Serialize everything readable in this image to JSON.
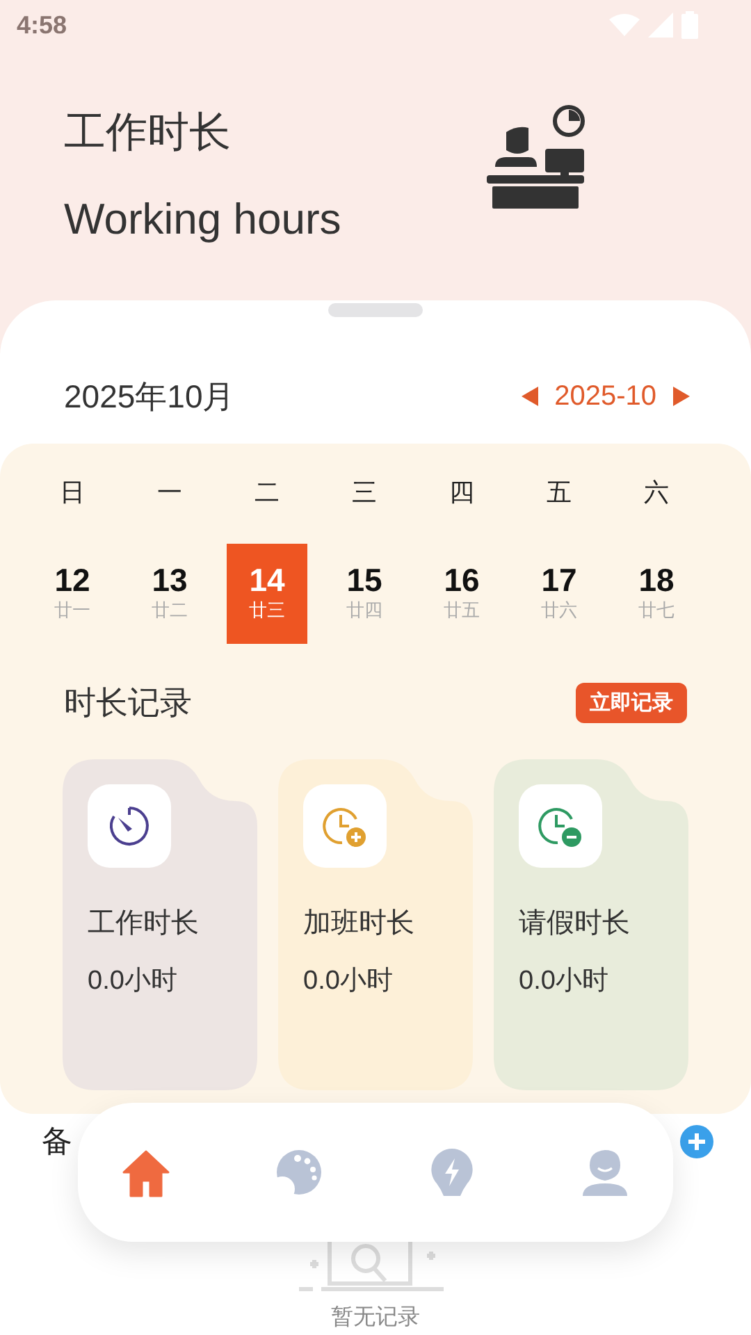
{
  "status_bar": {
    "time": "4:58"
  },
  "header": {
    "title": "工作时长",
    "subtitle": "Working hours"
  },
  "month": {
    "title": "2025年10月",
    "picker": "2025-10"
  },
  "calendar": {
    "weekdays": [
      "日",
      "一",
      "二",
      "三",
      "四",
      "五",
      "六"
    ],
    "days": [
      {
        "day": "12",
        "lunar": "廿一",
        "selected": false
      },
      {
        "day": "13",
        "lunar": "廿二",
        "selected": false
      },
      {
        "day": "14",
        "lunar": "廿三",
        "selected": true
      },
      {
        "day": "15",
        "lunar": "廿四",
        "selected": false
      },
      {
        "day": "16",
        "lunar": "廿五",
        "selected": false
      },
      {
        "day": "17",
        "lunar": "廿六",
        "selected": false
      },
      {
        "day": "18",
        "lunar": "廿七",
        "selected": false
      }
    ]
  },
  "records": {
    "title": "时长记录",
    "button": "立即记录",
    "cards": [
      {
        "kind": "work",
        "label": "工作时长",
        "value": "0.0小时",
        "color": "#ede5e3"
      },
      {
        "kind": "overtime",
        "label": "加班时长",
        "value": "0.0小时",
        "color": "#fdf0d8"
      },
      {
        "kind": "leave",
        "label": "请假时长",
        "value": "0.0小时",
        "color": "#e8ecdb"
      }
    ]
  },
  "notes": {
    "title": "备"
  },
  "empty": {
    "text": "暂无记录"
  },
  "nav": {
    "items": [
      {
        "kind": "home",
        "selected": true
      },
      {
        "kind": "palette",
        "selected": false
      },
      {
        "kind": "bulb",
        "selected": false
      },
      {
        "kind": "profile",
        "selected": false
      }
    ]
  }
}
